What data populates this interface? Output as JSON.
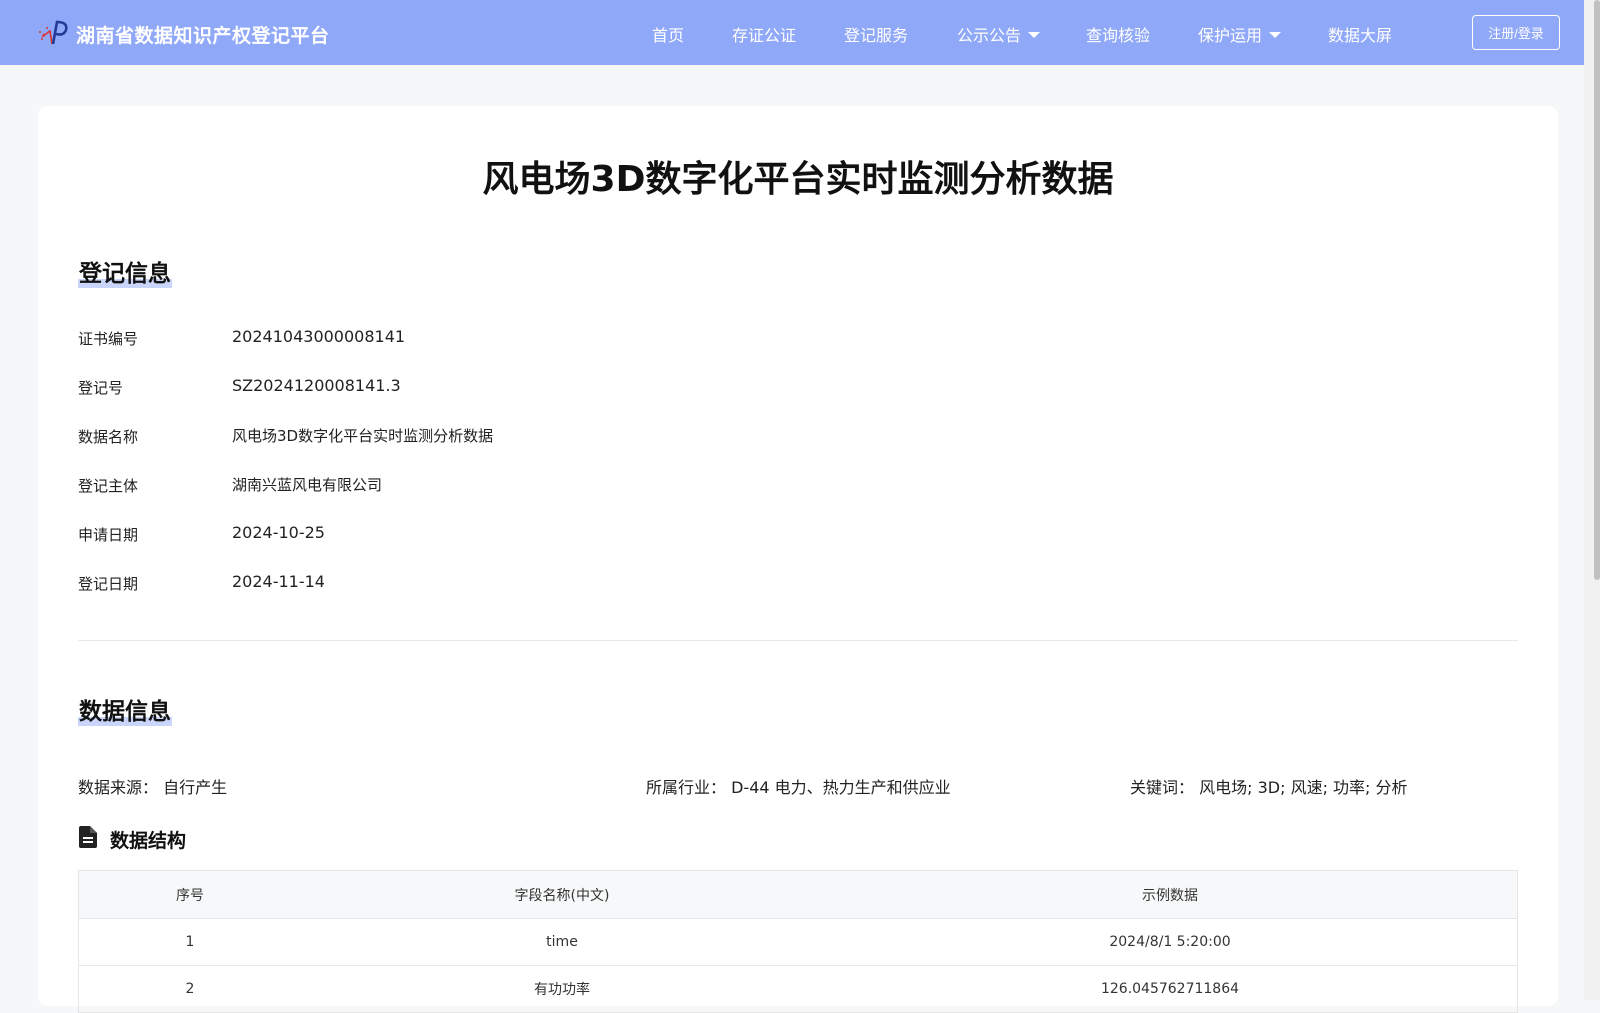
{
  "header": {
    "logo_icon": "platform-logo-icon",
    "site_title": "湖南省数据知识产权登记平台",
    "nav": [
      {
        "label": "首页"
      },
      {
        "label": "存证公证"
      },
      {
        "label": "登记服务"
      },
      {
        "label": "公示公告"
      },
      {
        "label": "查询核验"
      },
      {
        "label": "保护运用"
      },
      {
        "label": "数据大屏"
      }
    ],
    "login_label": "注册/登录",
    "bg_color": "#90a8f8"
  },
  "page": {
    "title": "风电场3D数字化平台实时监测分析数据"
  },
  "registration": {
    "heading": "登记信息",
    "rows": [
      {
        "label": "证书编号",
        "value": "20241043000008141"
      },
      {
        "label": "登记号",
        "value": "SZ2024120008141.3"
      },
      {
        "label": "数据名称",
        "value": "风电场3D数字化平台实时监测分析数据"
      },
      {
        "label": "登记主体",
        "value": "湖南兴蓝风电有限公司"
      },
      {
        "label": "申请日期",
        "value": "2024-10-25"
      },
      {
        "label": "登记日期",
        "value": "2024-11-14"
      }
    ]
  },
  "data_info": {
    "heading": "数据信息",
    "source_label": "数据来源：",
    "source_value": "自行产生",
    "industry_label": "所属行业：",
    "industry_value": "D-44 电力、热力生产和供应业",
    "keywords_label": "关键词：",
    "keywords_value": "风电场; 3D; 风速; 功率; 分析"
  },
  "structure": {
    "icon": "document-icon",
    "heading": "数据结构",
    "columns": [
      "序号",
      "字段名称(中文)",
      "示例数据"
    ],
    "rows": [
      [
        "1",
        "time",
        "2024/8/1 5:20:00"
      ],
      [
        "2",
        "有功功率",
        "126.045762711864"
      ]
    ]
  }
}
